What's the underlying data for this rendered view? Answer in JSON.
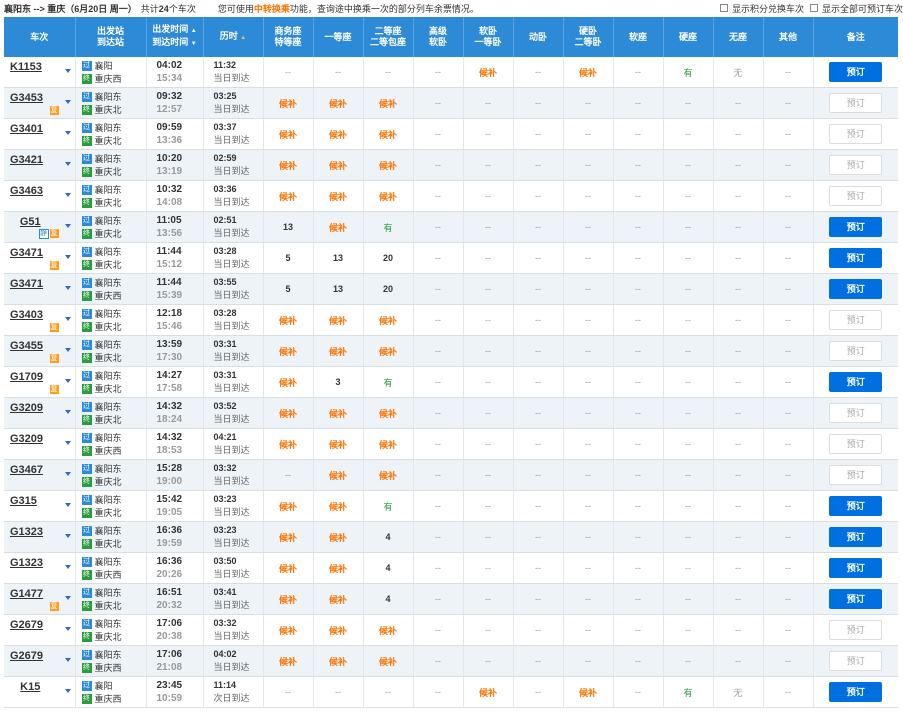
{
  "header": {
    "route": "襄阳东 --> 重庆（6月20日  周一）",
    "count_pre": "共计",
    "count_num": "24",
    "count_post": "个车次",
    "tip_pre": "您可使用",
    "tip_hl": "中转换乘",
    "tip_post": "功能，查询途中换乘一次的部分列车余票情况。",
    "chk_points": "显示积分兑换车次",
    "chk_all": "显示全部可预订车次"
  },
  "columns": {
    "train": "车次",
    "station_a": "出发站",
    "station_b": "到达站",
    "time_a": "出发时间",
    "time_b": "到达时间",
    "duration": "历时",
    "business_a": "商务座",
    "business_b": "特等座",
    "first": "一等座",
    "second_a": "二等座",
    "second_b": "二等包座",
    "hisoft": "高级",
    "hisoft_b": "软卧",
    "softsleep_a": "软卧",
    "softsleep_b": "一等卧",
    "dongwo": "动卧",
    "hardsleep_a": "硬卧",
    "hardsleep_b": "二等卧",
    "softseat": "软座",
    "hardseat": "硬座",
    "noseat": "无座",
    "other": "其他",
    "remark": "备注"
  },
  "icons": {
    "shi": "始",
    "guo": "过",
    "zhong": "终",
    "fu": "复",
    "jing": "静"
  },
  "colors": {
    "header": "#2d8ad6",
    "book": "#0070e0",
    "houbu": "#ff7200",
    "you": "#2a9b3e"
  },
  "rows": [
    {
      "no": "K1153",
      "tags": [],
      "from": "襄阳",
      "from_icon": "过",
      "to": "重庆西",
      "to_icon": "终",
      "dep": "04:02",
      "arr": "15:34",
      "dur": "11:32",
      "day": "当日到达",
      "seats": [
        "--",
        "--",
        "--",
        "--",
        "候补",
        "--",
        "候补",
        "--",
        "有",
        "无",
        "--"
      ],
      "book": "预订",
      "bookable": true
    },
    {
      "no": "G3453",
      "tags": [
        "复"
      ],
      "from": "襄阳东",
      "from_icon": "过",
      "to": "重庆北",
      "to_icon": "终",
      "dep": "09:32",
      "arr": "12:57",
      "dur": "03:25",
      "day": "当日到达",
      "seats": [
        "候补",
        "候补",
        "候补",
        "--",
        "--",
        "--",
        "--",
        "--",
        "--",
        "--",
        "--"
      ],
      "book": "预订",
      "bookable": false
    },
    {
      "no": "G3401",
      "tags": [],
      "from": "襄阳东",
      "from_icon": "过",
      "to": "重庆北",
      "to_icon": "终",
      "dep": "09:59",
      "arr": "13:36",
      "dur": "03:37",
      "day": "当日到达",
      "seats": [
        "候补",
        "候补",
        "候补",
        "--",
        "--",
        "--",
        "--",
        "--",
        "--",
        "--",
        "--"
      ],
      "book": "预订",
      "bookable": false
    },
    {
      "no": "G3421",
      "tags": [],
      "from": "襄阳东",
      "from_icon": "过",
      "to": "重庆北",
      "to_icon": "终",
      "dep": "10:20",
      "arr": "13:19",
      "dur": "02:59",
      "day": "当日到达",
      "seats": [
        "候补",
        "候补",
        "候补",
        "--",
        "--",
        "--",
        "--",
        "--",
        "--",
        "--",
        "--"
      ],
      "book": "预订",
      "bookable": false
    },
    {
      "no": "G3463",
      "tags": [],
      "from": "襄阳东",
      "from_icon": "过",
      "to": "重庆北",
      "to_icon": "终",
      "dep": "10:32",
      "arr": "14:08",
      "dur": "03:36",
      "day": "当日到达",
      "seats": [
        "候补",
        "候补",
        "候补",
        "--",
        "--",
        "--",
        "--",
        "--",
        "--",
        "--",
        "--"
      ],
      "book": "预订",
      "bookable": false
    },
    {
      "no": "G51",
      "tags": [
        "静",
        "复"
      ],
      "from": "襄阳东",
      "from_icon": "过",
      "to": "重庆北",
      "to_icon": "终",
      "dep": "11:05",
      "arr": "13:56",
      "dur": "02:51",
      "day": "当日到达",
      "seats": [
        "13",
        "候补",
        "有",
        "--",
        "--",
        "--",
        "--",
        "--",
        "--",
        "--",
        "--"
      ],
      "book": "预订",
      "bookable": true
    },
    {
      "no": "G3471",
      "tags": [
        "复"
      ],
      "from": "襄阳东",
      "from_icon": "过",
      "to": "重庆北",
      "to_icon": "终",
      "dep": "11:44",
      "arr": "15:12",
      "dur": "03:28",
      "day": "当日到达",
      "seats": [
        "5",
        "13",
        "20",
        "--",
        "--",
        "--",
        "--",
        "--",
        "--",
        "--",
        "--"
      ],
      "book": "预订",
      "bookable": true
    },
    {
      "no": "G3471",
      "tags": [],
      "from": "襄阳东",
      "from_icon": "过",
      "to": "重庆西",
      "to_icon": "终",
      "dep": "11:44",
      "arr": "15:39",
      "dur": "03:55",
      "day": "当日到达",
      "seats": [
        "5",
        "13",
        "20",
        "--",
        "--",
        "--",
        "--",
        "--",
        "--",
        "--",
        "--"
      ],
      "book": "预订",
      "bookable": true
    },
    {
      "no": "G3403",
      "tags": [
        "复"
      ],
      "from": "襄阳东",
      "from_icon": "过",
      "to": "重庆北",
      "to_icon": "终",
      "dep": "12:18",
      "arr": "15:46",
      "dur": "03:28",
      "day": "当日到达",
      "seats": [
        "候补",
        "候补",
        "候补",
        "--",
        "--",
        "--",
        "--",
        "--",
        "--",
        "--",
        "--"
      ],
      "book": "预订",
      "bookable": false
    },
    {
      "no": "G3455",
      "tags": [
        "复"
      ],
      "from": "襄阳东",
      "from_icon": "过",
      "to": "重庆北",
      "to_icon": "终",
      "dep": "13:59",
      "arr": "17:30",
      "dur": "03:31",
      "day": "当日到达",
      "seats": [
        "候补",
        "候补",
        "候补",
        "--",
        "--",
        "--",
        "--",
        "--",
        "--",
        "--",
        "--"
      ],
      "book": "预订",
      "bookable": false
    },
    {
      "no": "G1709",
      "tags": [
        "复"
      ],
      "from": "襄阳东",
      "from_icon": "过",
      "to": "重庆北",
      "to_icon": "终",
      "dep": "14:27",
      "arr": "17:58",
      "dur": "03:31",
      "day": "当日到达",
      "seats": [
        "候补",
        "3",
        "有",
        "--",
        "--",
        "--",
        "--",
        "--",
        "--",
        "--",
        "--"
      ],
      "book": "预订",
      "bookable": true
    },
    {
      "no": "G3209",
      "tags": [],
      "from": "襄阳东",
      "from_icon": "过",
      "to": "重庆北",
      "to_icon": "终",
      "dep": "14:32",
      "arr": "18:24",
      "dur": "03:52",
      "day": "当日到达",
      "seats": [
        "候补",
        "候补",
        "候补",
        "--",
        "--",
        "--",
        "--",
        "--",
        "--",
        "--",
        "--"
      ],
      "book": "预订",
      "bookable": false
    },
    {
      "no": "G3209",
      "tags": [],
      "from": "襄阳东",
      "from_icon": "过",
      "to": "重庆西",
      "to_icon": "终",
      "dep": "14:32",
      "arr": "18:53",
      "dur": "04:21",
      "day": "当日到达",
      "seats": [
        "候补",
        "候补",
        "候补",
        "--",
        "--",
        "--",
        "--",
        "--",
        "--",
        "--",
        "--"
      ],
      "book": "预订",
      "bookable": false
    },
    {
      "no": "G3467",
      "tags": [],
      "from": "襄阳东",
      "from_icon": "过",
      "to": "重庆北",
      "to_icon": "终",
      "dep": "15:28",
      "arr": "19:00",
      "dur": "03:32",
      "day": "当日到达",
      "seats": [
        "--",
        "候补",
        "候补",
        "--",
        "--",
        "--",
        "--",
        "--",
        "--",
        "--",
        "--"
      ],
      "book": "预订",
      "bookable": false
    },
    {
      "no": "G315",
      "tags": [],
      "from": "襄阳东",
      "from_icon": "过",
      "to": "重庆北",
      "to_icon": "终",
      "dep": "15:42",
      "arr": "19:05",
      "dur": "03:23",
      "day": "当日到达",
      "seats": [
        "候补",
        "候补",
        "有",
        "--",
        "--",
        "--",
        "--",
        "--",
        "--",
        "--",
        "--"
      ],
      "book": "预订",
      "bookable": true
    },
    {
      "no": "G1323",
      "tags": [],
      "from": "襄阳东",
      "from_icon": "过",
      "to": "重庆北",
      "to_icon": "终",
      "dep": "16:36",
      "arr": "19:59",
      "dur": "03:23",
      "day": "当日到达",
      "seats": [
        "候补",
        "候补",
        "4",
        "--",
        "--",
        "--",
        "--",
        "--",
        "--",
        "--",
        "--"
      ],
      "book": "预订",
      "bookable": true
    },
    {
      "no": "G1323",
      "tags": [],
      "from": "襄阳东",
      "from_icon": "过",
      "to": "重庆西",
      "to_icon": "终",
      "dep": "16:36",
      "arr": "20:26",
      "dur": "03:50",
      "day": "当日到达",
      "seats": [
        "候补",
        "候补",
        "4",
        "--",
        "--",
        "--",
        "--",
        "--",
        "--",
        "--",
        "--"
      ],
      "book": "预订",
      "bookable": true
    },
    {
      "no": "G1477",
      "tags": [
        "复"
      ],
      "from": "襄阳东",
      "from_icon": "过",
      "to": "重庆北",
      "to_icon": "终",
      "dep": "16:51",
      "arr": "20:32",
      "dur": "03:41",
      "day": "当日到达",
      "seats": [
        "候补",
        "候补",
        "4",
        "--",
        "--",
        "--",
        "--",
        "--",
        "--",
        "--",
        "--"
      ],
      "book": "预订",
      "bookable": true
    },
    {
      "no": "G2679",
      "tags": [],
      "from": "襄阳东",
      "from_icon": "过",
      "to": "重庆北",
      "to_icon": "终",
      "dep": "17:06",
      "arr": "20:38",
      "dur": "03:32",
      "day": "当日到达",
      "seats": [
        "候补",
        "候补",
        "候补",
        "--",
        "--",
        "--",
        "--",
        "--",
        "--",
        "--",
        "--"
      ],
      "book": "预订",
      "bookable": false
    },
    {
      "no": "G2679",
      "tags": [],
      "from": "襄阳东",
      "from_icon": "过",
      "to": "重庆西",
      "to_icon": "终",
      "dep": "17:06",
      "arr": "21:08",
      "dur": "04:02",
      "day": "当日到达",
      "seats": [
        "候补",
        "候补",
        "候补",
        "--",
        "--",
        "--",
        "--",
        "--",
        "--",
        "--",
        "--"
      ],
      "book": "预订",
      "bookable": false
    },
    {
      "no": "K15",
      "tags": [],
      "from": "襄阳",
      "from_icon": "过",
      "to": "重庆西",
      "to_icon": "终",
      "dep": "23:45",
      "arr": "10:59",
      "dur": "11:14",
      "day": "次日到达",
      "seats": [
        "--",
        "--",
        "--",
        "--",
        "候补",
        "--",
        "候补",
        "--",
        "有",
        "无",
        "--"
      ],
      "book": "预订",
      "bookable": true
    }
  ]
}
